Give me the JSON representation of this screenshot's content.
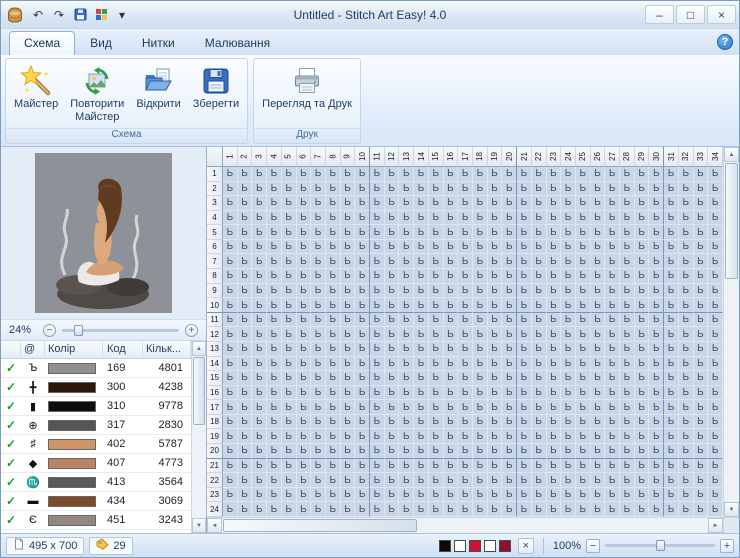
{
  "window": {
    "title": "Untitled - Stitch Art Easy! 4.0"
  },
  "titlebar": {
    "quick_access": [
      {
        "name": "undo-button",
        "icon": "undo-icon"
      },
      {
        "name": "redo-button",
        "icon": "redo-icon"
      },
      {
        "name": "quick-save-button",
        "icon": "save-small-icon"
      },
      {
        "name": "quick-colors-button",
        "icon": "colors-small-icon"
      },
      {
        "name": "qat-menu-button",
        "icon": "chevron-down-icon"
      }
    ]
  },
  "tabs": [
    {
      "id": "schema",
      "label": "Схема",
      "active": true
    },
    {
      "id": "vyd",
      "label": "Вид",
      "active": false
    },
    {
      "id": "nytky",
      "label": "Нитки",
      "active": false
    },
    {
      "id": "maliuvannia",
      "label": "Малювання",
      "active": false
    }
  ],
  "ribbon": {
    "groups": [
      {
        "label": "Схема",
        "buttons": [
          {
            "label": "Майстер",
            "icon": "wand-icon"
          },
          {
            "label": "Повторити\nМайстер",
            "icon": "repeat-wizard-icon"
          },
          {
            "label": "Відкрити",
            "icon": "open-folder-icon"
          },
          {
            "label": "Зберегти",
            "icon": "save-icon"
          }
        ]
      },
      {
        "label": "Друк",
        "buttons": [
          {
            "label": "Перегляд та Друк",
            "icon": "printer-icon"
          }
        ]
      }
    ]
  },
  "preview": {
    "zoom_value": "24%"
  },
  "palette_table": {
    "columns": [
      "@",
      "Колір",
      "Код",
      "Кільк..."
    ],
    "rows": [
      {
        "symbol": "Ъ",
        "color": "#8f8f8f",
        "code": "169",
        "count": "4801"
      },
      {
        "symbol": "╋",
        "color": "#2e1708",
        "code": "300",
        "count": "4238"
      },
      {
        "symbol": "▮",
        "color": "#0d0d0d",
        "code": "310",
        "count": "9778"
      },
      {
        "symbol": "⊕",
        "color": "#555555",
        "code": "317",
        "count": "2830"
      },
      {
        "symbol": "♯",
        "color": "#cf9566",
        "code": "402",
        "count": "5787"
      },
      {
        "symbol": "◆",
        "color": "#bb8161",
        "code": "407",
        "count": "4773"
      },
      {
        "symbol": "♏",
        "color": "#5a5a5e",
        "code": "413",
        "count": "3564"
      },
      {
        "symbol": "▬",
        "color": "#7a4b26",
        "code": "434",
        "count": "3069"
      },
      {
        "symbol": "Є",
        "color": "#948782",
        "code": "451",
        "count": "3243"
      }
    ]
  },
  "grid": {
    "cols": 34,
    "rows": 24,
    "first_col": 1,
    "first_row": 1,
    "symbol": "Ь"
  },
  "status_bar": {
    "size_label": "495 x 700",
    "count_label": "29",
    "zoom_label": "100%",
    "swatches": [
      "#0a0a0a",
      "#ffffff",
      "#cc1433",
      "#ffffff",
      "#8e1030"
    ]
  },
  "colors": {
    "accent": "#2a77c9",
    "grid_cell": "#c9d6e7",
    "grid_heavy_line": "#7b93b3",
    "check_green": "#1fa01f"
  }
}
